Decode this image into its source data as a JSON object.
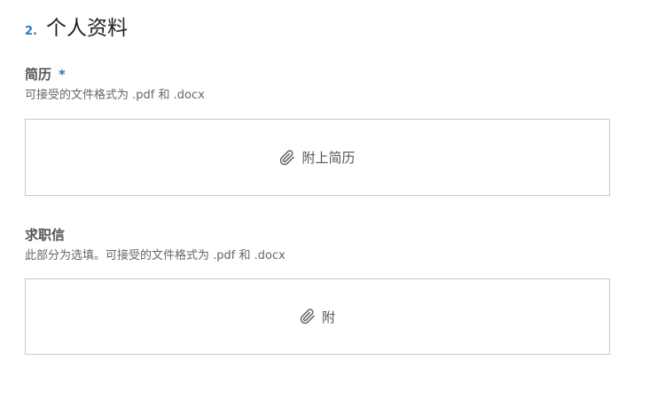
{
  "section": {
    "number": "2.",
    "title": "个人资料"
  },
  "resume": {
    "label": "简历",
    "required_mark": "*",
    "hint": "可接受的文件格式为 .pdf 和 .docx",
    "attach_label": "附上简历",
    "icon": "paperclip-icon"
  },
  "cover_letter": {
    "label": "求职信",
    "hint": "此部分为选填。可接受的文件格式为 .pdf 和 .docx",
    "attach_label": "附",
    "icon": "paperclip-icon"
  },
  "colors": {
    "accent": "#2b7bc0",
    "border": "#c8c8c8",
    "label": "#555555"
  }
}
